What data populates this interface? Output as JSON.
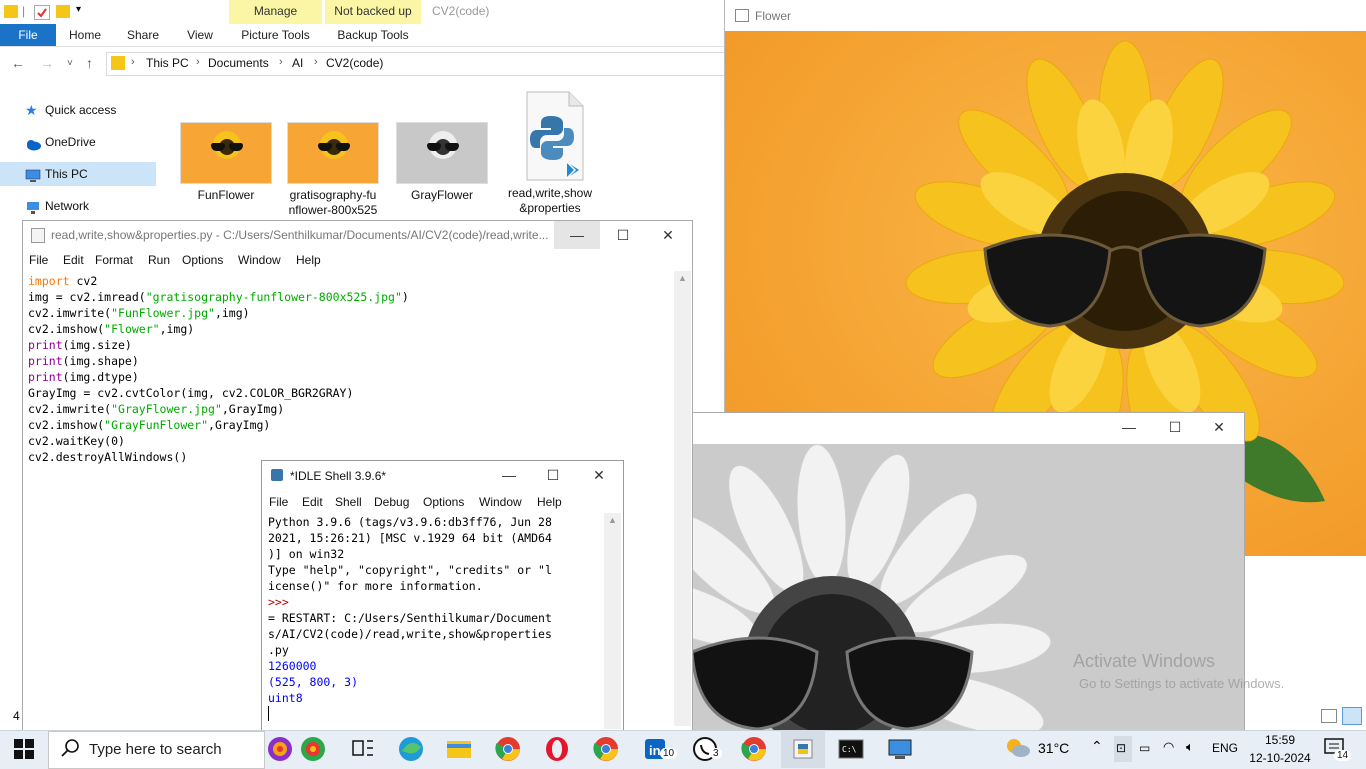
{
  "explorer": {
    "context_tabs": [
      {
        "label": "Manage",
        "sublabel": "Picture Tools"
      },
      {
        "label": "Not backed up",
        "sublabel": "Backup Tools"
      }
    ],
    "window_title": "CV2(code)",
    "ribbon_tabs": [
      "File",
      "Home",
      "Share",
      "View"
    ],
    "breadcrumb": [
      "This PC",
      "Documents",
      "AI",
      "CV2(code)"
    ],
    "nav_items": [
      "Quick access",
      "OneDrive",
      "This PC",
      "Network"
    ],
    "files": [
      {
        "name": "FunFlower",
        "type": "color-image"
      },
      {
        "name": "gratisography-funflower-800x525",
        "line1": "gratisography-fu",
        "line2": "nflower-800x525",
        "type": "color-image"
      },
      {
        "name": "GrayFlower",
        "type": "gray-image"
      },
      {
        "name": "read,write,show&properties",
        "line1": "read,write,show",
        "line2": "&properties",
        "type": "python-file"
      }
    ],
    "status_count": "4"
  },
  "editor": {
    "title": "read,write,show&properties.py - C:/Users/Senthilkumar/Documents/AI/CV2(code)/read,write...",
    "menu": [
      "File",
      "Edit",
      "Format",
      "Run",
      "Options",
      "Window",
      "Help"
    ],
    "code": [
      [
        {
          "t": "import",
          "c": "kw"
        },
        {
          "t": " cv2",
          "c": ""
        }
      ],
      [
        {
          "t": "img = cv2.imread(",
          "c": ""
        },
        {
          "t": "\"gratisography-funflower-800x525.jpg\"",
          "c": "str"
        },
        {
          "t": ")",
          "c": ""
        }
      ],
      [
        {
          "t": "cv2.imwrite(",
          "c": ""
        },
        {
          "t": "\"FunFlower.jpg\"",
          "c": "str"
        },
        {
          "t": ",img)",
          "c": ""
        }
      ],
      [
        {
          "t": "cv2.imshow(",
          "c": ""
        },
        {
          "t": "\"Flower\"",
          "c": "str"
        },
        {
          "t": ",img)",
          "c": ""
        }
      ],
      [
        {
          "t": "print",
          "c": "bi"
        },
        {
          "t": "(img.size)",
          "c": ""
        }
      ],
      [
        {
          "t": "print",
          "c": "bi"
        },
        {
          "t": "(img.shape)",
          "c": ""
        }
      ],
      [
        {
          "t": "print",
          "c": "bi"
        },
        {
          "t": "(img.dtype)",
          "c": ""
        }
      ],
      [
        {
          "t": "GrayImg = cv2.cvtColor(img, cv2.COLOR_BGR2GRAY)",
          "c": ""
        }
      ],
      [
        {
          "t": "cv2.imwrite(",
          "c": ""
        },
        {
          "t": "\"GrayFlower.jpg\"",
          "c": "str"
        },
        {
          "t": ",GrayImg)",
          "c": ""
        }
      ],
      [
        {
          "t": "cv2.imshow(",
          "c": ""
        },
        {
          "t": "\"GrayFunFlower\"",
          "c": "str"
        },
        {
          "t": ",GrayImg)",
          "c": ""
        }
      ],
      [
        {
          "t": "cv2.waitKey(0)",
          "c": ""
        }
      ],
      [
        {
          "t": "cv2.destroyAllWindows()",
          "c": ""
        }
      ]
    ]
  },
  "shell": {
    "title": "*IDLE Shell 3.9.6*",
    "menu": [
      "File",
      "Edit",
      "Shell",
      "Debug",
      "Options",
      "Window",
      "Help"
    ],
    "lines": [
      {
        "t": "Python 3.9.6 (tags/v3.9.6:db3ff76, Jun 28",
        "c": ""
      },
      {
        "t": "2021, 15:26:21) [MSC v.1929 64 bit (AMD64",
        "c": ""
      },
      {
        "t": ")] on win32",
        "c": ""
      },
      {
        "t": "Type \"help\", \"copyright\", \"credits\" or \"l",
        "c": ""
      },
      {
        "t": "icense()\" for more information.",
        "c": ""
      },
      {
        "t": ">>>",
        "c": "prompt"
      },
      {
        "t": "= RESTART: C:/Users/Senthilkumar/Document",
        "c": ""
      },
      {
        "t": "s/AI/CV2(code)/read,write,show&properties",
        "c": ""
      },
      {
        "t": ".py",
        "c": ""
      },
      {
        "t": "1260000",
        "c": "out"
      },
      {
        "t": "(525, 800, 3)",
        "c": "out"
      },
      {
        "t": "uint8",
        "c": "out"
      }
    ]
  },
  "flower_window": {
    "title": "Flower"
  },
  "gray_window": {
    "title": ""
  },
  "watermark": {
    "line1": "Activate Windows",
    "line2": "Go to Settings to activate Windows."
  },
  "taskbar": {
    "search_placeholder": "Type here to search",
    "badges": {
      "linkedin": "10",
      "whatsapp": "3"
    },
    "weather": "31°C",
    "language": "ENG",
    "time": "15:59",
    "date": "12-10-2024",
    "notifications": "14"
  },
  "colors": {
    "accent": "#1a73c7",
    "flower_bg": "#f7a535",
    "petal": "#f6c21d",
    "gray_bg": "#cfcfcf"
  }
}
